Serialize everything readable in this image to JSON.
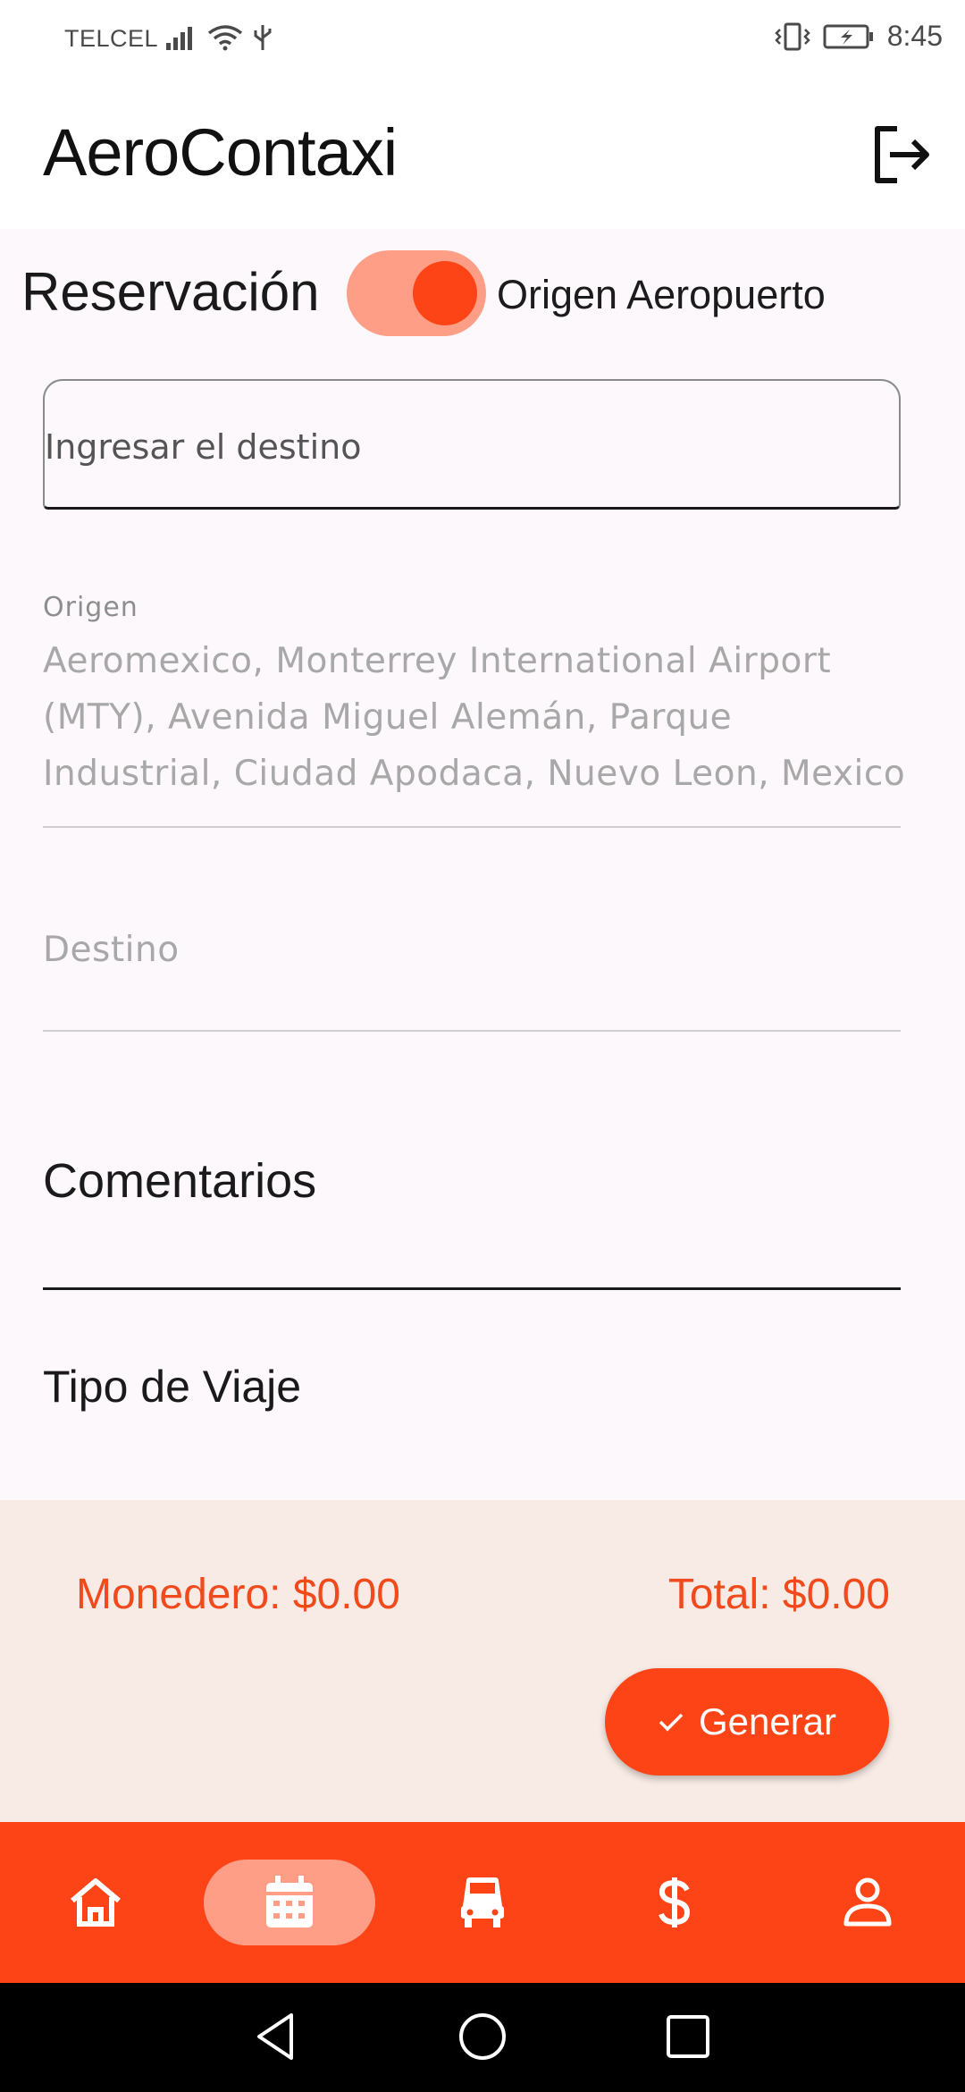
{
  "status_bar": {
    "carrier": "TELCEL",
    "time": "8:45"
  },
  "app_bar": {
    "title": "AeroContaxi"
  },
  "reservation": {
    "label": "Reservación",
    "toggle_on": true,
    "toggle_label": "Origen Aeropuerto"
  },
  "form": {
    "destination_placeholder": "Ingresar el destino",
    "origin_label": "Origen",
    "origin_value": "Aeromexico, Monterrey International Airport (MTY), Avenida Miguel Alemán, Parque Industrial, Ciudad Apodaca, Nuevo Leon, Mexico",
    "destino_label": "Destino",
    "comentarios_label": "Comentarios",
    "tipo_viaje_label": "Tipo de Viaje"
  },
  "summary": {
    "monedero": "Monedero: $0.00",
    "total": "Total: $0.00",
    "generar_label": "Generar"
  },
  "bottom_nav": {
    "items": [
      {
        "icon": "home-icon",
        "active": false
      },
      {
        "icon": "calendar-icon",
        "active": true
      },
      {
        "icon": "car-icon",
        "active": false
      },
      {
        "icon": "dollar-icon",
        "active": false
      },
      {
        "icon": "person-icon",
        "active": false
      }
    ]
  },
  "colors": {
    "accent": "#fc4416",
    "accent_light": "#ff9e86",
    "summary_bg": "#f8ebe6",
    "price_text": "#f14a1d"
  }
}
